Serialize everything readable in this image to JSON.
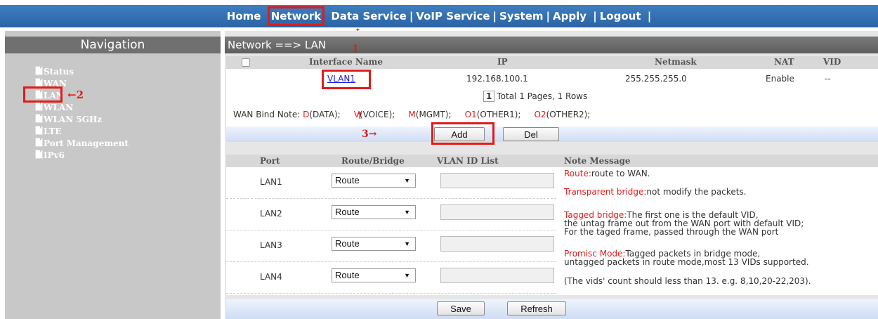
{
  "top_nav": {
    "items": [
      "Home",
      "Network",
      "Data Service",
      "VoIP Service",
      "System",
      "Apply",
      "Logout"
    ],
    "separator": "|",
    "active": "Network"
  },
  "annotations": {
    "arrow_up": "↑",
    "num1": "1",
    "arrow_left_2": "←2",
    "num3_arrow": "3→"
  },
  "sidebar": {
    "title": "Navigation",
    "items": [
      "Status",
      "WAN",
      "LAN",
      "WLAN",
      "WLAN 5GHz",
      "LTE",
      "Port Management",
      "IPv6"
    ]
  },
  "main": {
    "title": "Network ==> LAN",
    "table": {
      "columns": [
        "Interface Name",
        "IP",
        "Netmask",
        "NAT",
        "VID"
      ],
      "rows": [
        {
          "interface": "VLAN1",
          "ip": "192.168.100.1",
          "netmask": "255.255.255.0",
          "nat": "Enable",
          "vid": "--"
        }
      ]
    },
    "pager": {
      "page": "1",
      "summary": "Total 1 Pages, 1 Rows"
    },
    "wan_bind_note": {
      "label": "WAN Bind Note:",
      "items": [
        {
          "code": "D",
          "desc": "(DATA);"
        },
        {
          "code": "V",
          "desc": "(VOICE);"
        },
        {
          "code": "M",
          "desc": "(MGMT);"
        },
        {
          "code": "O1",
          "desc": "(OTHER1);"
        },
        {
          "code": "O2",
          "desc": "(OTHER2);"
        }
      ]
    },
    "buttons": {
      "add": "Add",
      "del": "Del",
      "save": "Save",
      "refresh": "Refresh"
    }
  },
  "lan_ports": {
    "columns": [
      "Port",
      "Route/Bridge",
      "VLAN ID List",
      "Note Message"
    ],
    "rows": [
      {
        "port": "LAN1",
        "mode": "Route",
        "vlan_ids": ""
      },
      {
        "port": "LAN2",
        "mode": "Route",
        "vlan_ids": ""
      },
      {
        "port": "LAN3",
        "mode": "Route",
        "vlan_ids": ""
      },
      {
        "port": "LAN4",
        "mode": "Route",
        "vlan_ids": ""
      }
    ],
    "notes": {
      "route_label": "Route:",
      "route_text": "route to WAN.",
      "transparent_label": "Transparent bridge:",
      "transparent_text": "not modify the packets.",
      "tagged_label": "Tagged bridge:",
      "tagged_line1": "The first one is the default VID,",
      "tagged_line2": "the untag frame out from the WAN port with default VID;",
      "tagged_line3": "For the taged frame, passed through the WAN port",
      "promisc_label": "Promisc Mode:",
      "promisc_line1": "Tagged packets in bridge mode,",
      "promisc_line2": "untagged packets in route mode,most 13 VIDs supported.",
      "vids_note": "(The vids' count should less than 13. e.g. 8,10,20-22,203)."
    }
  },
  "colors": {
    "accent": "#2a63a5",
    "highlight": "#e01b1b",
    "link": "#1a1adb"
  }
}
